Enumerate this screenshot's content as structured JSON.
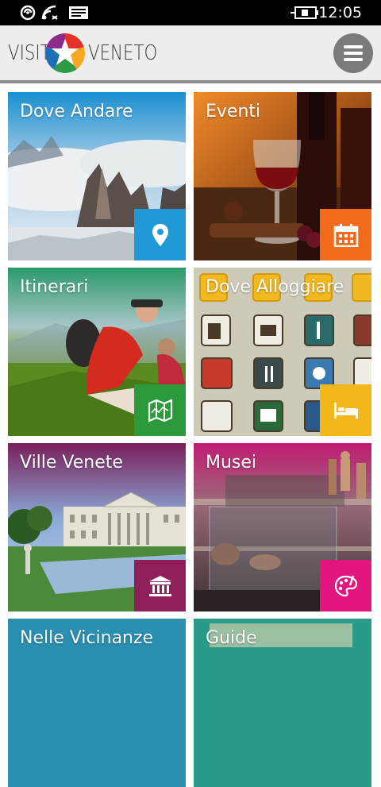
{
  "status_bar": {
    "time": "12:05"
  },
  "header": {
    "logo_left": "VISIT",
    "logo_right": "VENETO",
    "menu_icon": "hamburger-icon"
  },
  "tiles": [
    {
      "title": "Dove Andare",
      "icon": "map-pin-icon",
      "badge_color": "#1f9ad6"
    },
    {
      "title": "Eventi",
      "icon": "calendar-icon",
      "badge_color": "#f26a1b"
    },
    {
      "title": "Itinerari",
      "icon": "map-icon",
      "badge_color": "#2b9a3a"
    },
    {
      "title": "Dove Alloggiare",
      "icon": "bed-icon",
      "badge_color": "#f2b71b"
    },
    {
      "title": "Ville Venete",
      "icon": "museum-building-icon",
      "badge_color": "#8e1f5a"
    },
    {
      "title": "Musei",
      "icon": "palette-icon",
      "badge_color": "#e3167f"
    },
    {
      "title": "Nelle Vicinanze",
      "icon": "",
      "badge_color": ""
    },
    {
      "title": "Guide",
      "icon": "",
      "badge_color": ""
    }
  ]
}
